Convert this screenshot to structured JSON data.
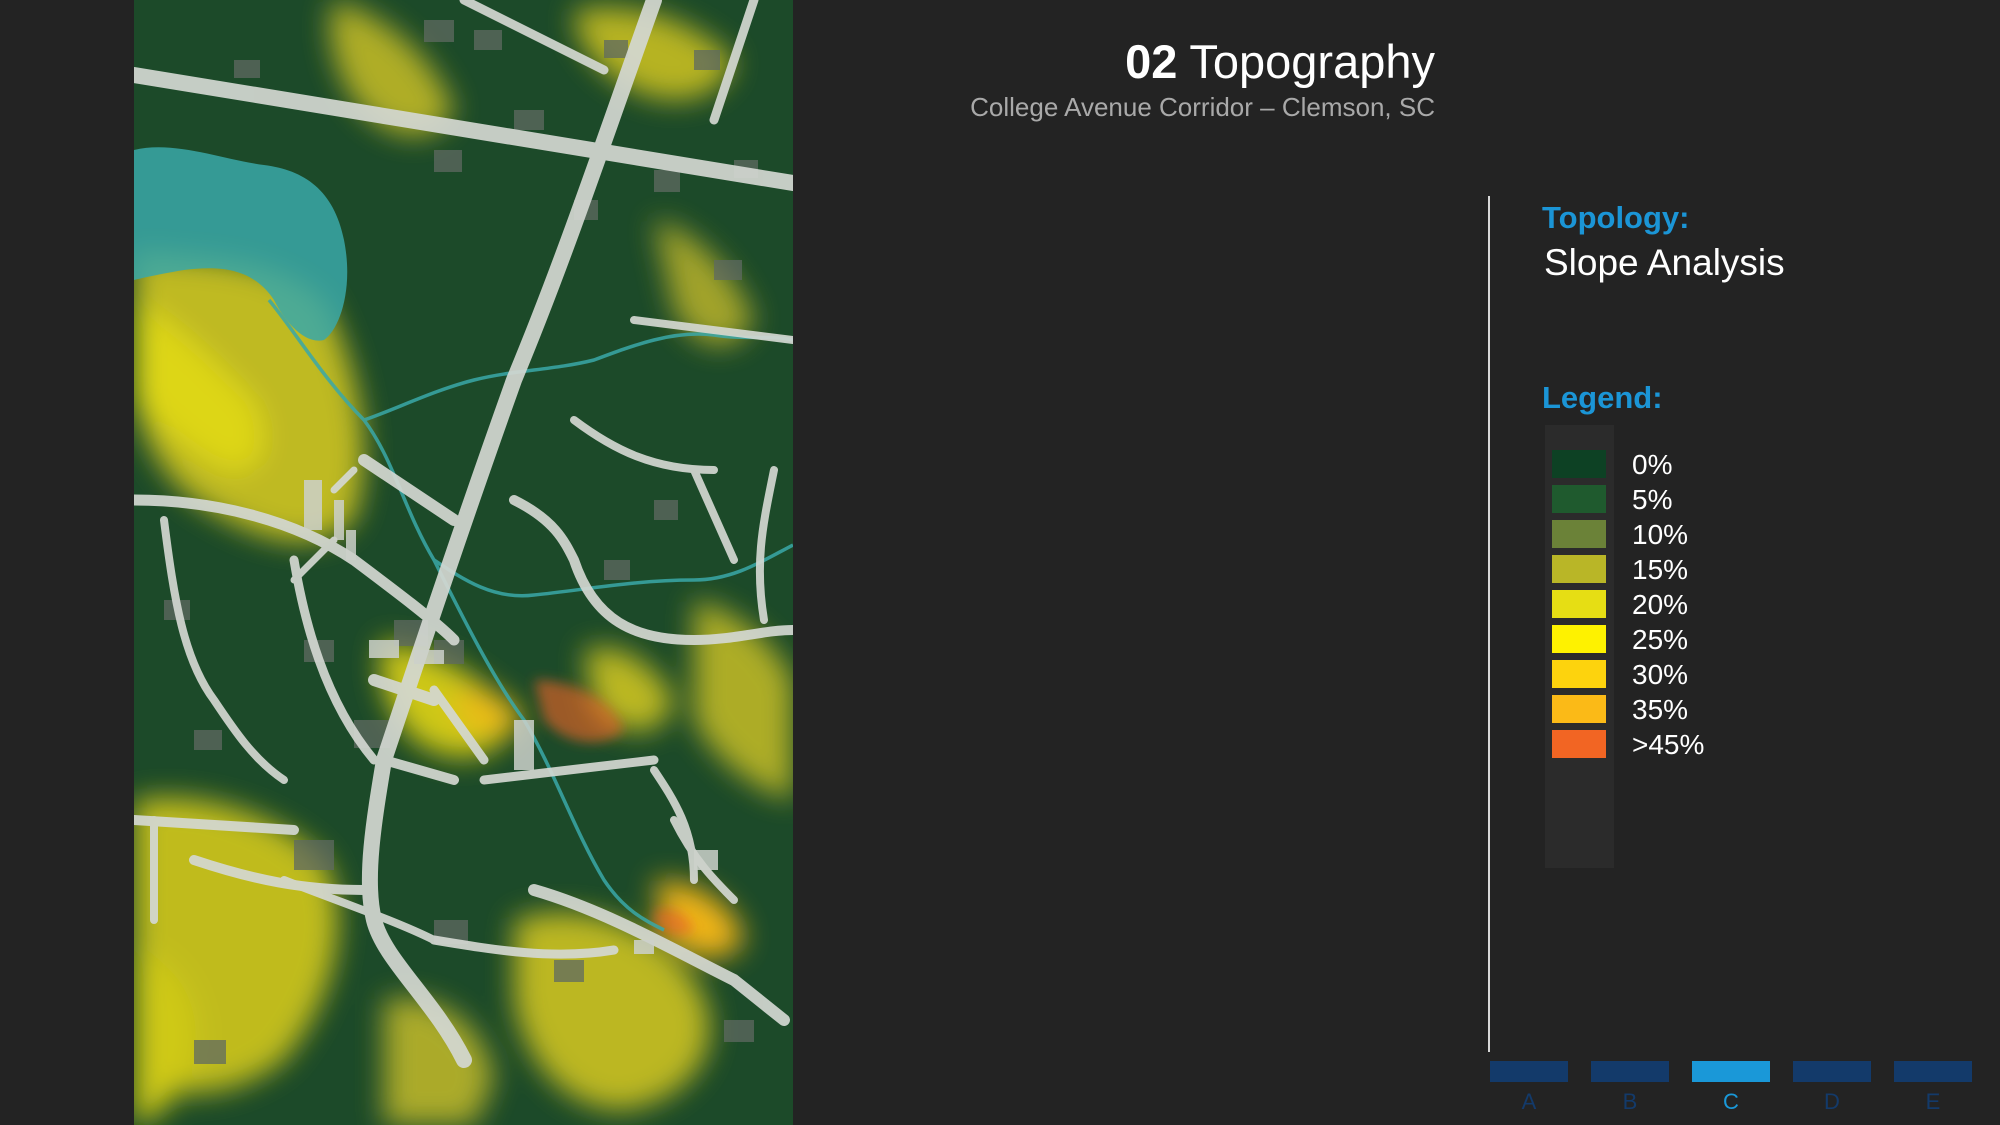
{
  "header": {
    "number": "02",
    "title": "Topography",
    "subtitle": "College Avenue Corridor – Clemson, SC"
  },
  "panel": {
    "topic_label": "Topology:",
    "topic_value": "Slope Analysis",
    "legend_label": "Legend:"
  },
  "legend": [
    {
      "label": "0%",
      "color": "#0d4124"
    },
    {
      "label": "5%",
      "color": "#1f5a2e"
    },
    {
      "label": "10%",
      "color": "#6b8238"
    },
    {
      "label": "15%",
      "color": "#b9b627"
    },
    {
      "label": "20%",
      "color": "#e6de14"
    },
    {
      "label": "25%",
      "color": "#fef200"
    },
    {
      "label": "30%",
      "color": "#fdd30d"
    },
    {
      "label": "35%",
      "color": "#fbba17"
    },
    {
      "label": ">45%",
      "color": "#f26523"
    }
  ],
  "nav": {
    "tabs": [
      "A",
      "B",
      "C",
      "D",
      "E"
    ],
    "active": "C"
  },
  "colors": {
    "accent": "#1a98d8",
    "nav_inactive": "#133a6a",
    "water": "#3aa8a8",
    "roads": "#d4d8d2"
  }
}
